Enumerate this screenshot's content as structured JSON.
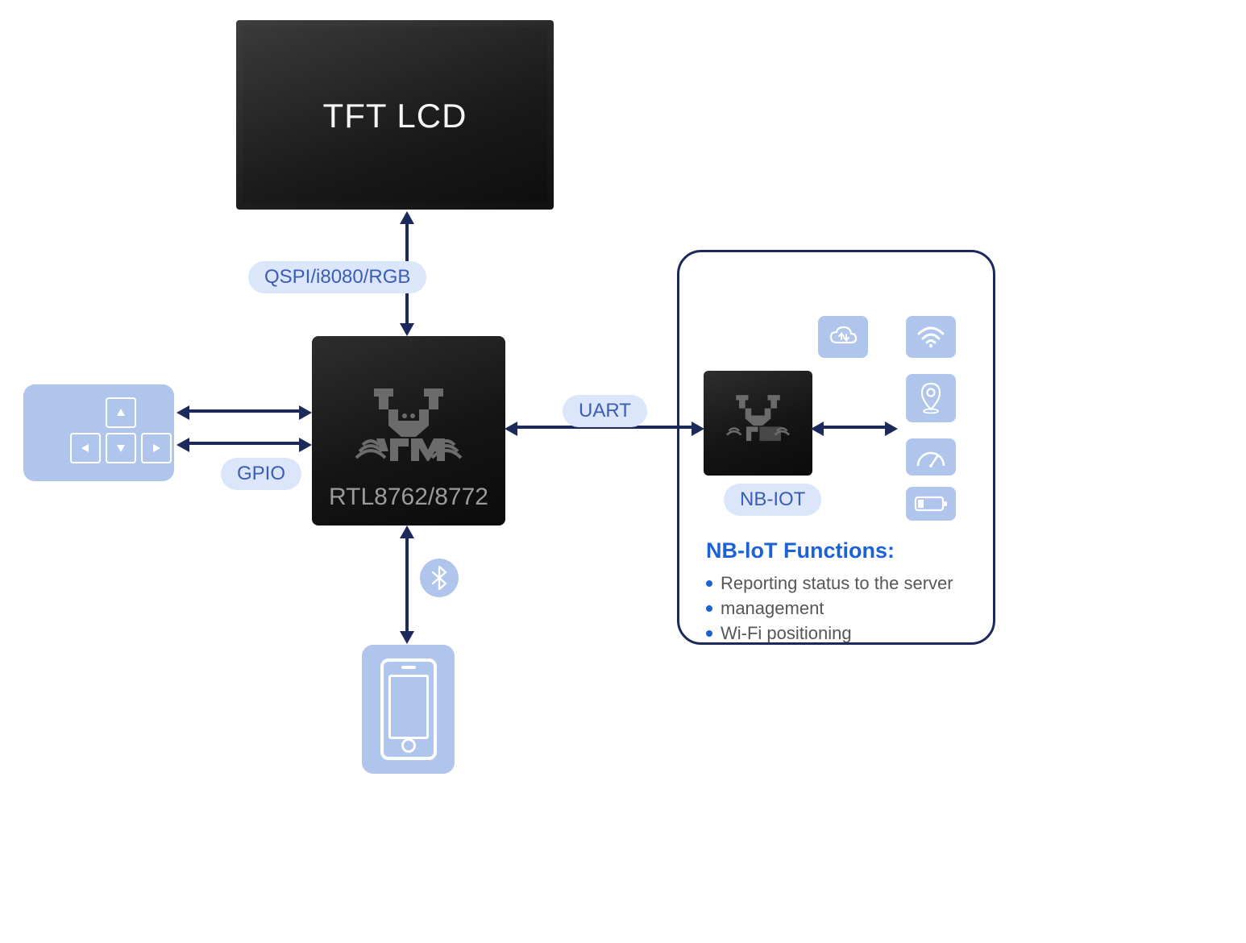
{
  "lcd": {
    "title": "TFT LCD"
  },
  "chip": {
    "label": "RTL8762/8772"
  },
  "badges": {
    "display_if": "QSPI/i8080/RGB",
    "gpio": "GPIO",
    "uart": "UART",
    "nbiot": "NB-IOT"
  },
  "nb_panel": {
    "heading": "NB-loT Functions:",
    "items": [
      "Reporting status to the server",
      "management",
      "Wi-Fi positioning"
    ]
  },
  "icons": {
    "dpad": "dpad-keys",
    "phone": "smartphone",
    "bluetooth": "bluetooth",
    "cloud": "cloud-sync",
    "wifi": "wifi",
    "location": "location-pin",
    "gauge": "speed-gauge",
    "battery": "battery-low"
  },
  "colors": {
    "accent_blue": "#1c62d6",
    "badge_bg": "#dbe6fb",
    "tile_bg": "#b0c5ec",
    "arrow": "#1b2a5a",
    "chip_bg": "#181818"
  }
}
